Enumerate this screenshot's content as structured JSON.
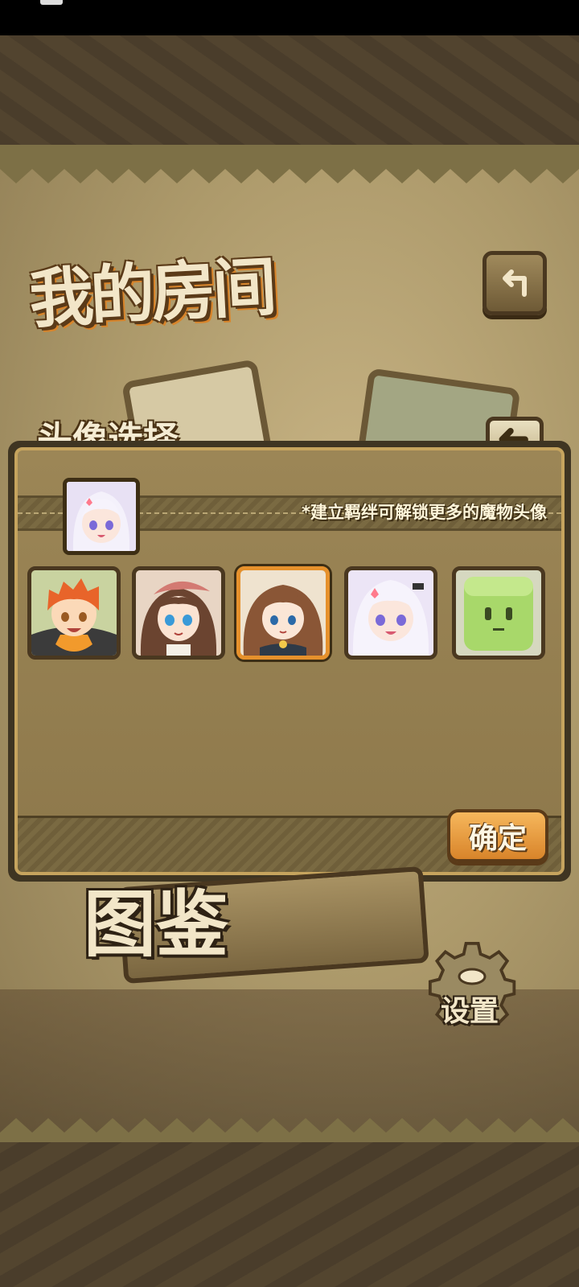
{
  "screen": {
    "title": "我的房间",
    "colors": {
      "accent": "#d8842a",
      "parchment": "#c9b586",
      "frame": "#3f3522"
    }
  },
  "header": {
    "back_icon": "return-arrow-icon"
  },
  "avatar_select": {
    "title": "头像选择",
    "hint": "*建立羁绊可解锁更多的魔物头像",
    "current": {
      "icon": "white-haired-girl-avatar"
    },
    "options": [
      {
        "icon": "orange-haired-boy-avatar",
        "selected": false
      },
      {
        "icon": "brown-haired-girl-hat-avatar",
        "selected": false
      },
      {
        "icon": "brown-haired-chibi-girl-avatar",
        "selected": true
      },
      {
        "icon": "white-haired-girl-avatar",
        "selected": false
      },
      {
        "icon": "green-slime-avatar",
        "selected": false
      }
    ],
    "confirm_label": "确定"
  },
  "bottom_menu": {
    "encyclopedia_label": "图鉴",
    "settings_label": "设置"
  }
}
